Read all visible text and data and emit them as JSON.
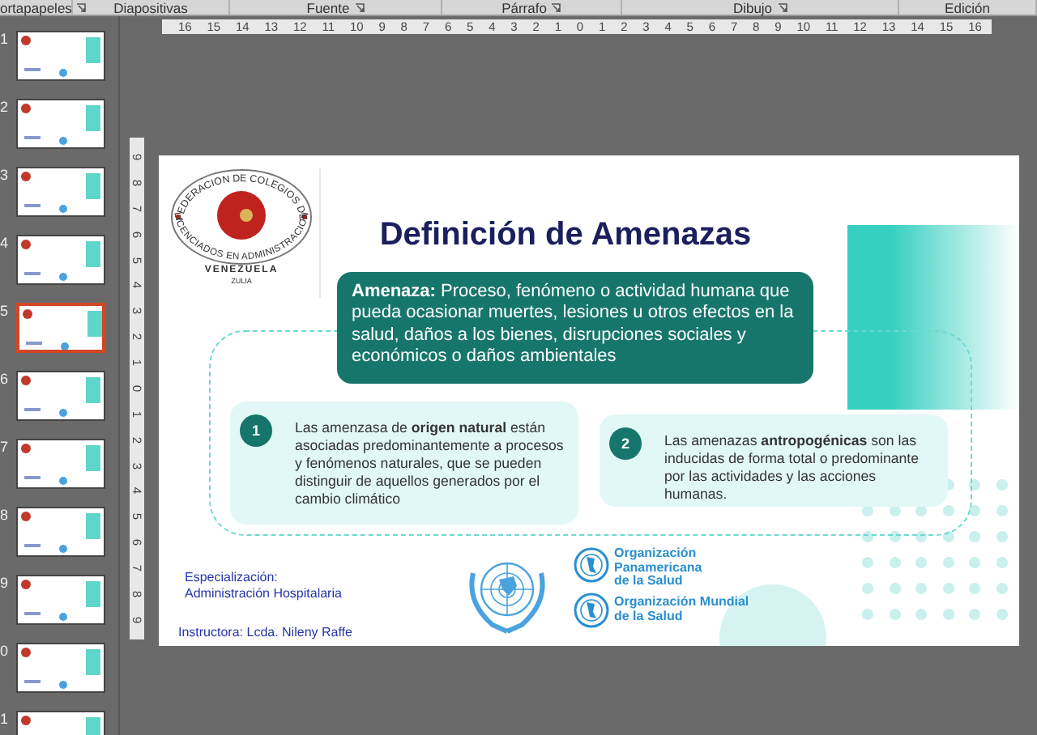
{
  "ribbon_groups": [
    {
      "label": "ortapapeles",
      "launcher": true
    },
    {
      "label": "Diapositivas",
      "launcher": false
    },
    {
      "label": "Fuente",
      "launcher": true
    },
    {
      "label": "Párrafo",
      "launcher": true
    },
    {
      "label": "Dibujo",
      "launcher": true
    },
    {
      "label": "Edición",
      "launcher": false
    }
  ],
  "thumbnails": [
    {
      "number": "1",
      "selected": false
    },
    {
      "number": "2",
      "selected": false
    },
    {
      "number": "3",
      "selected": false
    },
    {
      "number": "4",
      "selected": false
    },
    {
      "number": "5",
      "selected": true
    },
    {
      "number": "6",
      "selected": false
    },
    {
      "number": "7",
      "selected": false
    },
    {
      "number": "8",
      "selected": false
    },
    {
      "number": "9",
      "selected": false
    },
    {
      "number": "0",
      "selected": false
    },
    {
      "number": "1",
      "selected": false
    }
  ],
  "horizontal_ruler": [
    "16",
    "15",
    "14",
    "13",
    "12",
    "11",
    "10",
    "9",
    "8",
    "7",
    "6",
    "5",
    "4",
    "3",
    "2",
    "1",
    "0",
    "1",
    "2",
    "3",
    "4",
    "5",
    "6",
    "7",
    "8",
    "9",
    "10",
    "11",
    "12",
    "13",
    "14",
    "15",
    "16"
  ],
  "vertical_ruler": [
    "9",
    "8",
    "7",
    "6",
    "5",
    "4",
    "3",
    "2",
    "1",
    "0",
    "1",
    "2",
    "3",
    "4",
    "5",
    "6",
    "7",
    "8",
    "9"
  ],
  "slide": {
    "logo": {
      "ring_top": "FEDERACION DE COLEGIOS DE",
      "ring_bottom": "LICENCIADOS EN ADMINISTRACION",
      "country": "VENEZUELA",
      "region": "ZULIA"
    },
    "title": "Definición de Amenazas",
    "definition": "**Amenaza:** Proceso, fenómeno o actividad humana que pueda ocasionar muertes, lesiones u otros efectos en la salud, daños a los bienes, disrupciones sociales y económicos o daños ambientales",
    "cards": [
      {
        "number": "1",
        "text": "Las amenzasa de **origen natural** están asociadas predominantemente a procesos y fenómenos naturales, que se pueden distinguir de aquellos  generados por el cambio climático"
      },
      {
        "number": "2",
        "text": "Las amenazas **antropogénicas** son las inducidas de forma total o predominante por las actividades y las acciones humanas."
      }
    ],
    "specialization": [
      "Especialización:",
      "Administración Hospitalaria"
    ],
    "instructor": "Instructora: Lcda. Nileny  Raffe",
    "organizations": [
      "Organización Panamericana de la Salud",
      "Organización Mundial de la Salud"
    ]
  }
}
